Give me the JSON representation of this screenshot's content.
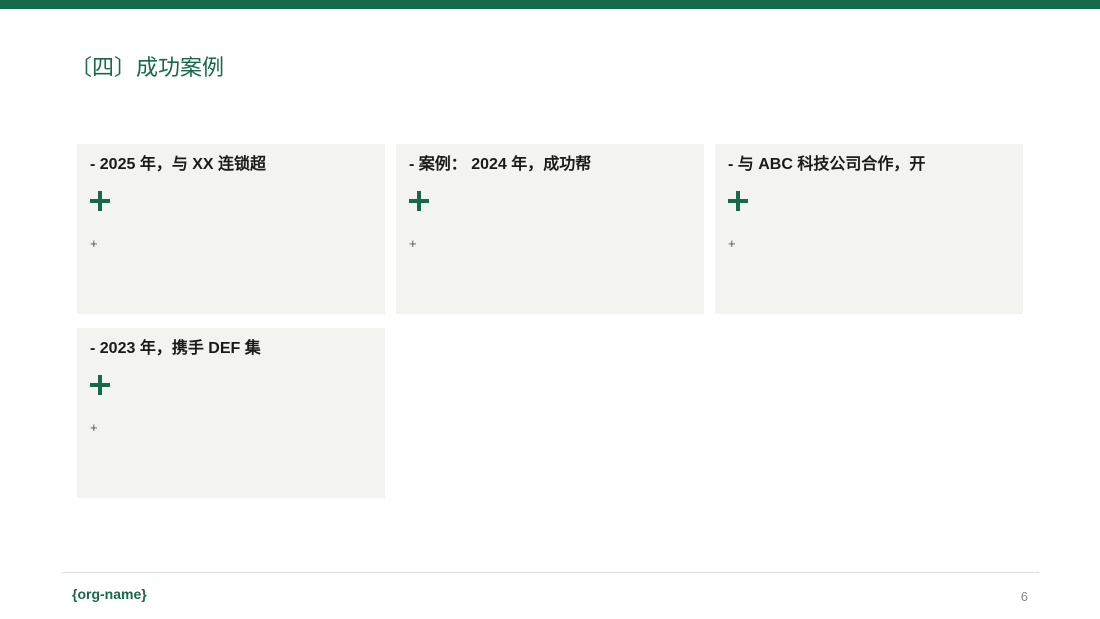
{
  "colors": {
    "accent": "#166a4b",
    "card_background": "#f3f3f0",
    "heading_text": "#1a1a1a"
  },
  "slide": {
    "title": "〔四〕成功案例"
  },
  "cards": [
    {
      "heading": "- 2025 年，与 XX 连锁超",
      "plus_icon": "plus-icon",
      "body": "+"
    },
    {
      "heading": "-  案例： 2024 年，成功帮",
      "plus_icon": "plus-icon",
      "body": "+"
    },
    {
      "heading": "-  与 ABC 科技公司合作，开",
      "plus_icon": "plus-icon",
      "body": "+"
    },
    {
      "heading": "- 2023 年，携手 DEF 集",
      "plus_icon": "plus-icon",
      "body": "+"
    }
  ],
  "footer": {
    "org_name": "{org-name}",
    "page_number": "6"
  }
}
